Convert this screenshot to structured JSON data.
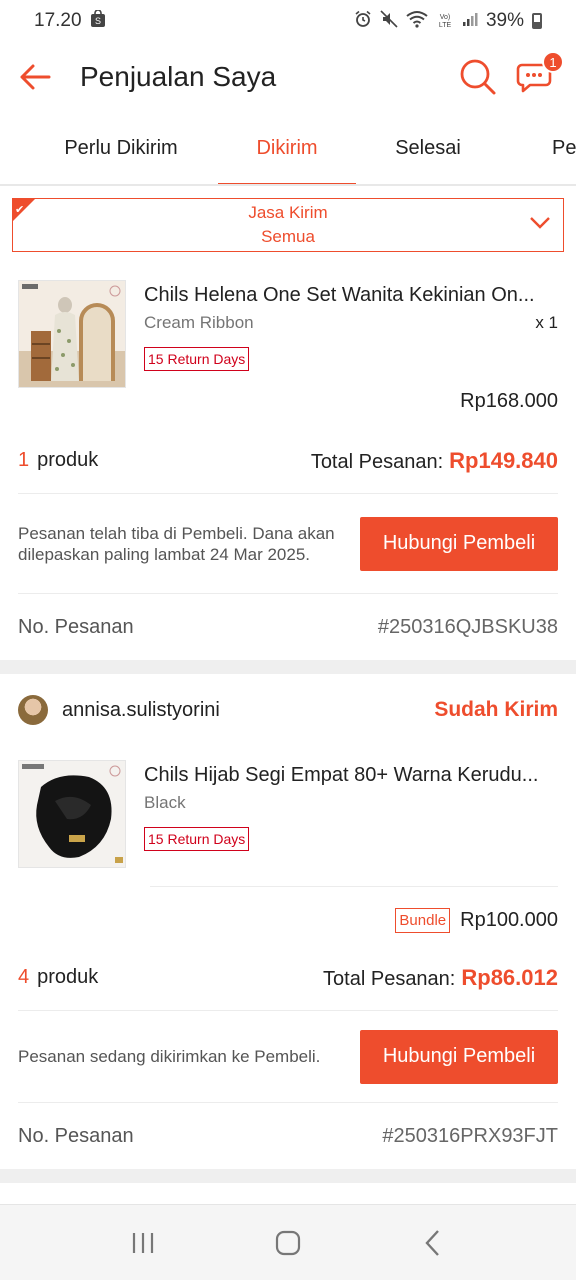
{
  "status_bar": {
    "time": "17.20",
    "battery": "39%"
  },
  "header": {
    "title": "Penjualan Saya",
    "chat_badge": "1"
  },
  "tabs": [
    {
      "label": "Perlu Dikirim",
      "active": false
    },
    {
      "label": "Dikirim",
      "active": true
    },
    {
      "label": "Selesai",
      "active": false
    },
    {
      "label": "Pem",
      "active": false
    }
  ],
  "filter": {
    "label": "Jasa Kirim",
    "value": "Semua"
  },
  "orders": [
    {
      "product": {
        "name": "Chils Helena One Set Wanita Kekinian On...",
        "variant": "Cream Ribbon",
        "qty": "x 1",
        "tag": "15 Return Days",
        "price": "Rp168.000"
      },
      "count_num": "1",
      "count_label": "produk",
      "total_label": "Total Pesanan:",
      "total_value": "Rp149.840",
      "action_text": "Pesanan telah tiba di Pembeli. Dana akan dilepaskan paling lambat 24 Mar 2025.",
      "action_button": "Hubungi Pembeli",
      "order_no_label": "No. Pesanan",
      "order_no": "#250316QJBSKU38"
    },
    {
      "shop_name": "annisa.sulistyorini",
      "status": "Sudah Kirim",
      "product": {
        "name": "Chils Hijab Segi Empat 80+ Warna Kerudu...",
        "variant": "Black",
        "tag": "15 Return Days",
        "bundle": "Bundle",
        "price": "Rp100.000"
      },
      "count_num": "4",
      "count_label": "produk",
      "total_label": "Total Pesanan:",
      "total_value": "Rp86.012",
      "action_text": "Pesanan sedang dikirimkan ke Pembeli.",
      "action_button": "Hubungi Pembeli",
      "order_no_label": "No. Pesanan",
      "order_no": "#250316PRX93FJT"
    }
  ],
  "colors": {
    "accent": "#ee4d2d",
    "tag_red": "#d0011b"
  }
}
